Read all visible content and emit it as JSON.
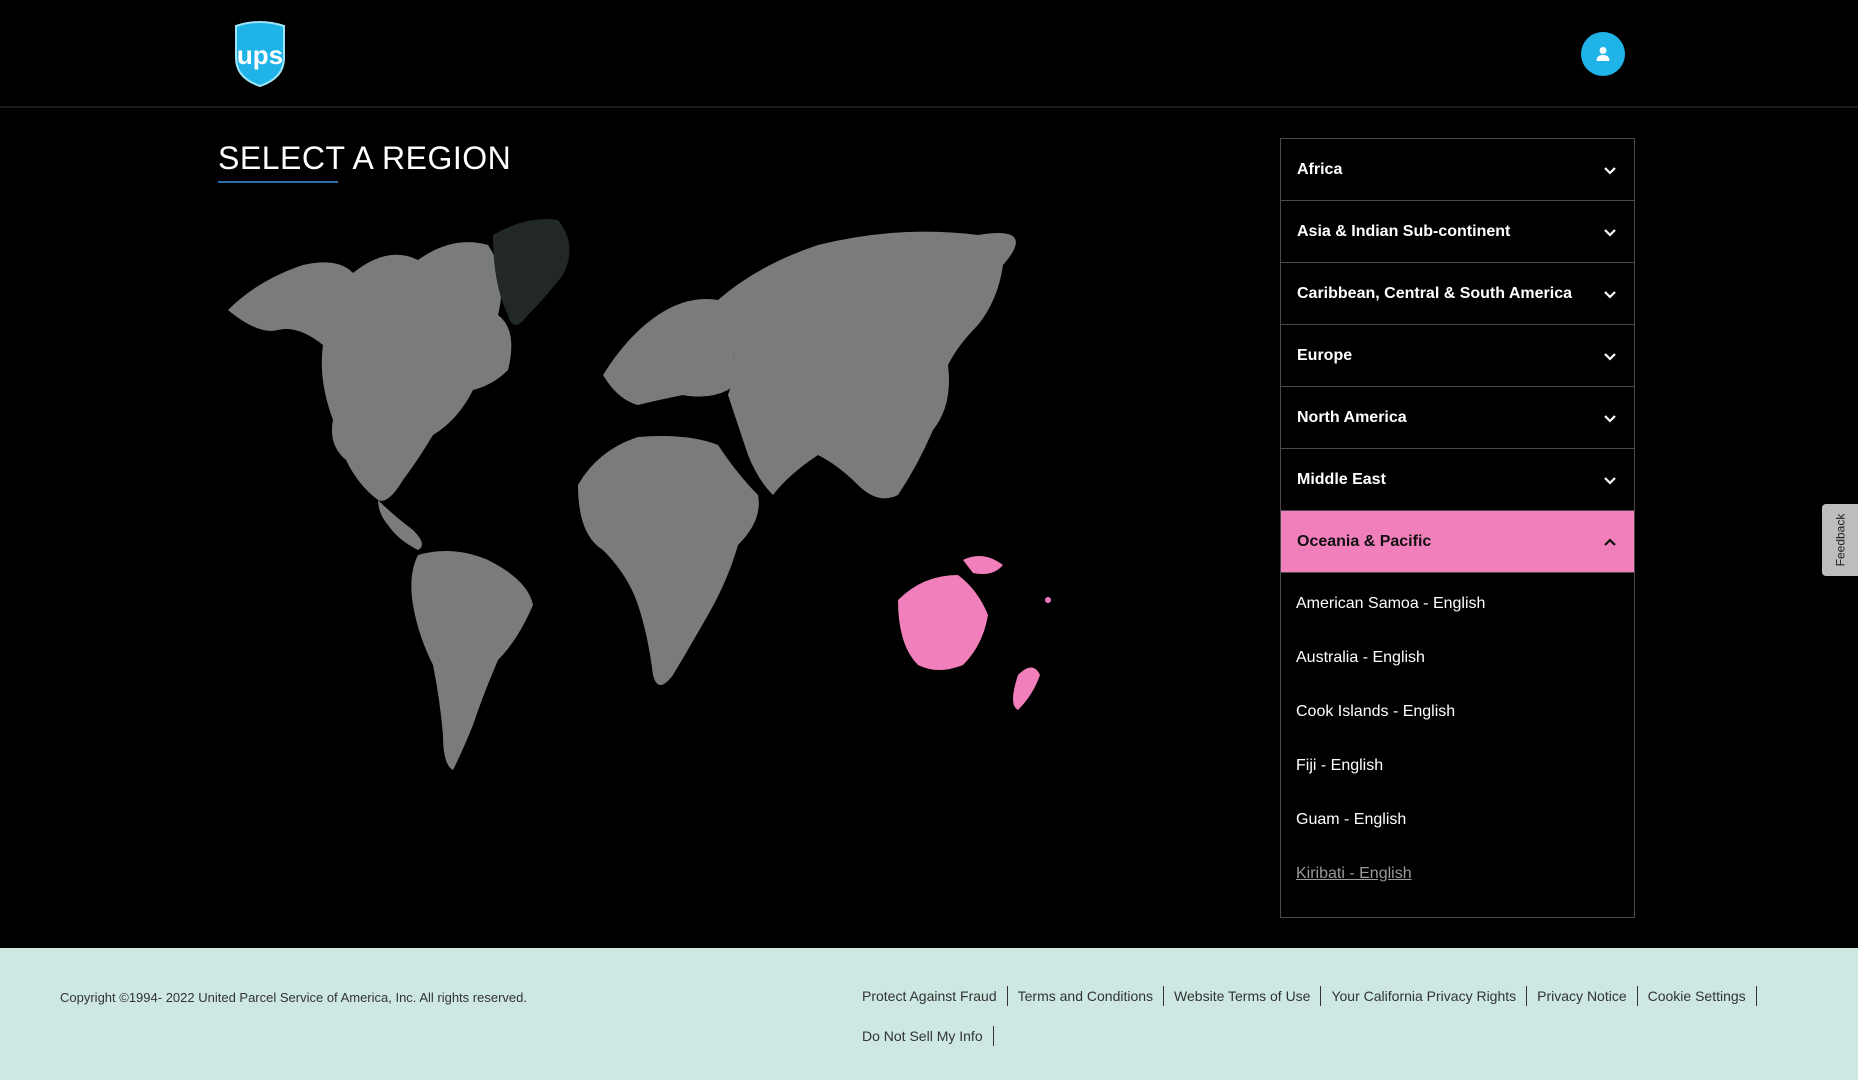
{
  "header": {
    "logo_text": "ups",
    "logo_icon": "ups-shield-logo",
    "user_icon": "user-icon"
  },
  "main": {
    "title": "SELECT A REGION",
    "map_icon": "world-map",
    "highlight_color": "#f17fbb"
  },
  "regions": [
    {
      "label": "Africa",
      "expanded": false
    },
    {
      "label": "Asia & Indian Sub-continent",
      "expanded": false
    },
    {
      "label": "Caribbean, Central & South America",
      "expanded": false
    },
    {
      "label": "Europe",
      "expanded": false
    },
    {
      "label": "North America",
      "expanded": false
    },
    {
      "label": "Middle East",
      "expanded": false
    },
    {
      "label": "Oceania & Pacific",
      "expanded": true
    }
  ],
  "oceania_countries": [
    "American Samoa - English",
    "Australia - English",
    "Cook Islands - English",
    "Fiji - English",
    "Guam - English",
    "Kiribati - English"
  ],
  "feedback_label": "Feedback",
  "footer": {
    "copyright": "Copyright ©1994- 2022  United Parcel Service of America, Inc. All rights reserved.",
    "links": [
      "Protect Against Fraud",
      "Terms and Conditions",
      "Website Terms of Use",
      "Your California Privacy Rights",
      "Privacy Notice",
      "Cookie Settings",
      "Do Not Sell My Info"
    ]
  }
}
